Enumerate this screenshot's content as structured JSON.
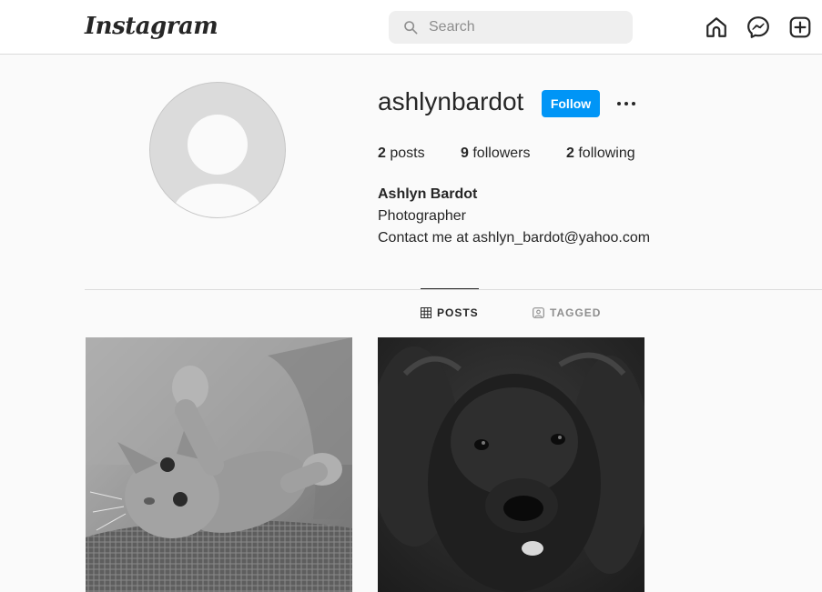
{
  "header": {
    "logo": "Instagram",
    "search_placeholder": "Search",
    "icons": [
      "home-icon",
      "messenger-icon",
      "new-post-icon"
    ]
  },
  "profile": {
    "username": "ashlynbardot",
    "follow_label": "Follow",
    "stats": {
      "posts_count": "2",
      "posts_label": "posts",
      "followers_count": "9",
      "followers_label": "followers",
      "following_count": "2",
      "following_label": "following"
    },
    "full_name": "Ashlyn Bardot",
    "bio_lines": [
      "Photographer",
      "Contact me at ashlyn_bardot@yahoo.com"
    ]
  },
  "tabs": [
    {
      "label": "POSTS",
      "active": true
    },
    {
      "label": "TAGGED",
      "active": false
    }
  ],
  "posts": [
    {
      "subject": "kitten"
    },
    {
      "subject": "dog"
    }
  ],
  "colors": {
    "accent": "#0095f6",
    "border": "#dbdbdb",
    "text": "#262626",
    "muted": "#8e8e8e"
  }
}
